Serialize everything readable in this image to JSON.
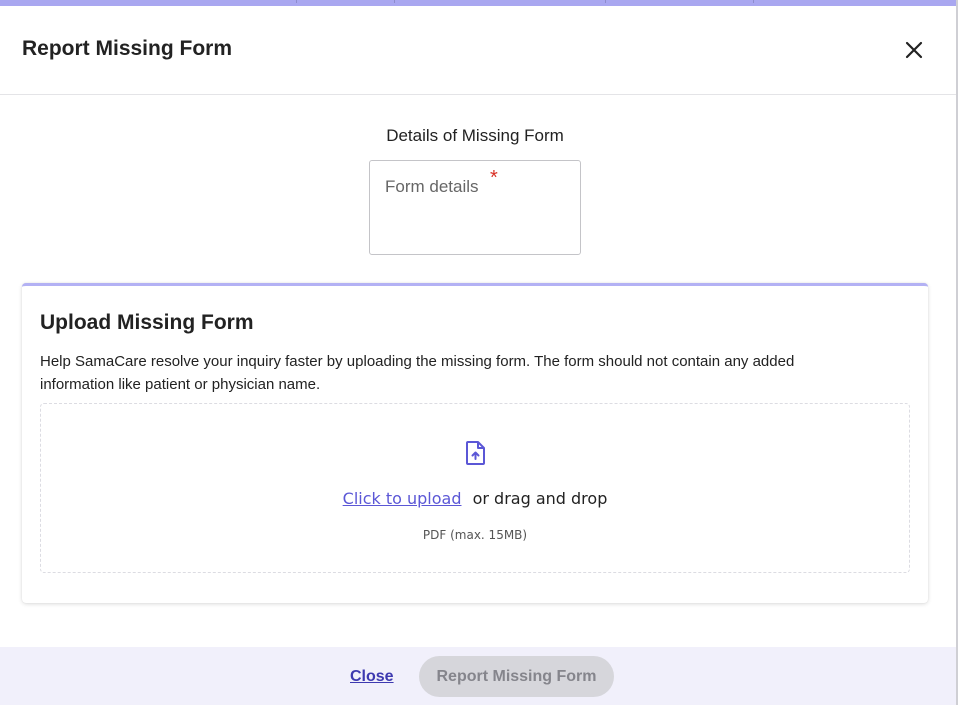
{
  "modal": {
    "title": "Report Missing Form",
    "close_icon": "close-icon"
  },
  "details": {
    "label": "Details of Missing Form",
    "placeholder": "Form details",
    "required_marker": "*"
  },
  "upload": {
    "title": "Upload Missing Form",
    "help_text": "Help SamaCare resolve your inquiry faster by uploading the missing form. The form should not contain any added information like patient or physician name.",
    "icon": "file-upload-icon",
    "link_label": "Click to upload",
    "drag_text": "or drag and drop",
    "hint": "PDF (max. 15MB)"
  },
  "footer": {
    "close_label": "Close",
    "submit_label": "Report Missing Form"
  },
  "colors": {
    "accent": "#5b57d6",
    "accent_light": "#b3b1f4",
    "footer_bg": "#f1f0fb",
    "required": "#d93025",
    "disabled_button": "#d6d6db"
  }
}
